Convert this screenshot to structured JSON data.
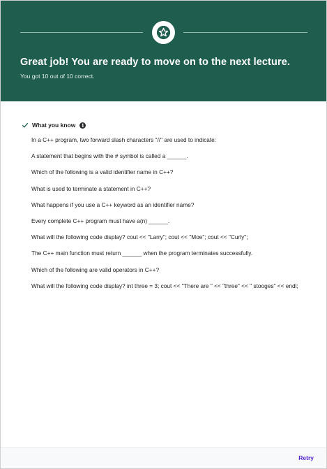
{
  "header": {
    "title": "Great job! You are ready to move on to the next lecture.",
    "subtitle": "You got 10 out of 10 correct.",
    "badge_icon": "star-icon",
    "color": "#1f5e4f"
  },
  "section": {
    "title": "What you know",
    "check_icon": "check-icon",
    "info_icon": "info-icon",
    "info_glyph": "i"
  },
  "questions": [
    "In a C++ program, two forward slash characters \"//\" are used to indicate:",
    "A statement that begins with the # symbol is called a ______.",
    "Which of the following is a valid identifier name in C++?",
    "What is used to terminate a statement in C++?",
    "What happens if you use a C++ keyword as an identifier name?",
    "Every complete C++ program must have a(n) ______.",
    "What will the following code display? cout << \"Larry\"; cout << \"Moe\"; cout << \"Curly\";",
    "The C++ main function must return ______ when the program terminates successfully.",
    "Which of the following are valid operators in C++?",
    "What will the following code display?  int three = 3; cout << \"There are \" << \"three\" << \" stooges\" << endl;"
  ],
  "footer": {
    "retry_label": "Retry",
    "accent": "#5624d0"
  }
}
